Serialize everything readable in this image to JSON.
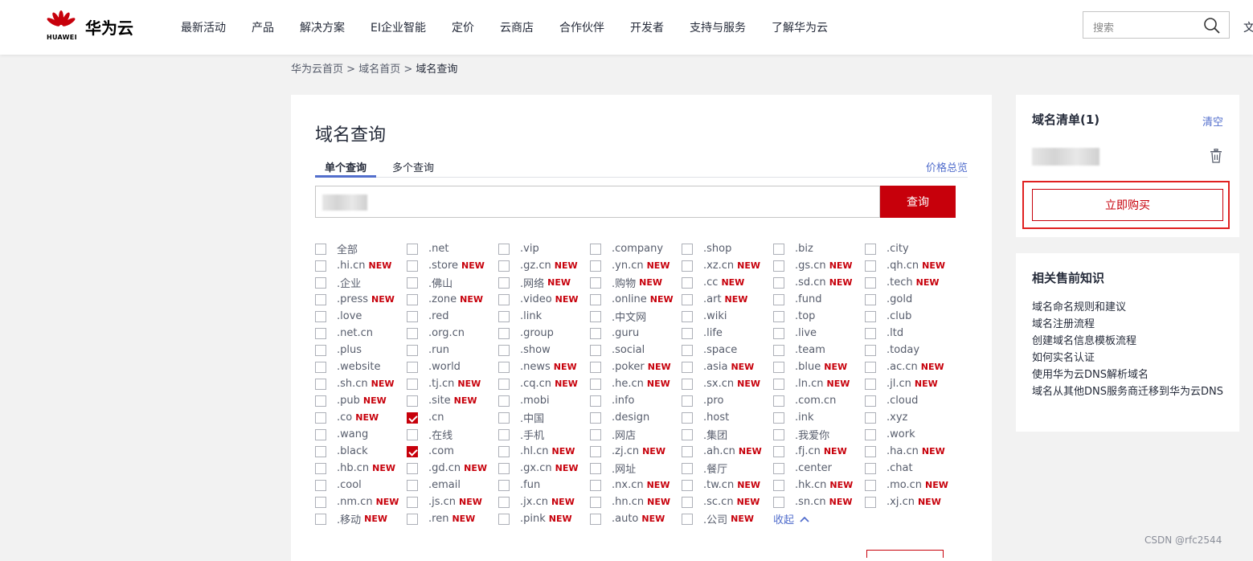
{
  "header": {
    "brand": "HUAWEI",
    "site_name": "华为云",
    "nav": [
      "最新活动",
      "产品",
      "解决方案",
      "EI企业智能",
      "定价",
      "云商店",
      "合作伙伴",
      "开发者",
      "支持与服务",
      "了解华为云"
    ],
    "search_placeholder": "搜索",
    "more": "文"
  },
  "breadcrumb": {
    "items": [
      "华为云首页",
      "域名首页"
    ],
    "current": "域名查询",
    "sep": ">"
  },
  "main": {
    "title": "域名查询",
    "tabs": [
      "单个查询",
      "多个查询"
    ],
    "price_link": "价格总览",
    "query_button": "查询",
    "new_tag": "NEW",
    "collapse": "收起",
    "suffix_rows": [
      [
        [
          "全部",
          false,
          false
        ],
        [
          ".net",
          false,
          false
        ],
        [
          ".vip",
          false,
          false
        ],
        [
          ".company",
          false,
          false
        ],
        [
          ".shop",
          false,
          false
        ],
        [
          ".biz",
          false,
          false
        ],
        [
          ".city",
          false,
          false
        ]
      ],
      [
        [
          ".hi.cn",
          true,
          false
        ],
        [
          ".store",
          true,
          false
        ],
        [
          ".gz.cn",
          true,
          false
        ],
        [
          ".yn.cn",
          true,
          false
        ],
        [
          ".xz.cn",
          true,
          false
        ],
        [
          ".gs.cn",
          true,
          false
        ],
        [
          ".qh.cn",
          true,
          false
        ]
      ],
      [
        [
          ".企业",
          false,
          false
        ],
        [
          ".佛山",
          false,
          false
        ],
        [
          ".网络",
          true,
          false
        ],
        [
          ".购物",
          true,
          false
        ],
        [
          ".cc",
          true,
          false
        ],
        [
          ".sd.cn",
          true,
          false
        ],
        [
          ".tech",
          true,
          false
        ]
      ],
      [
        [
          ".press",
          true,
          false
        ],
        [
          ".zone",
          true,
          false
        ],
        [
          ".video",
          true,
          false
        ],
        [
          ".online",
          true,
          false
        ],
        [
          ".art",
          true,
          false
        ],
        [
          ".fund",
          false,
          false
        ],
        [
          ".gold",
          false,
          false
        ]
      ],
      [
        [
          ".love",
          false,
          false
        ],
        [
          ".red",
          false,
          false
        ],
        [
          ".link",
          false,
          false
        ],
        [
          ".中文网",
          false,
          false
        ],
        [
          ".wiki",
          false,
          false
        ],
        [
          ".top",
          false,
          false
        ],
        [
          ".club",
          false,
          false
        ]
      ],
      [
        [
          ".net.cn",
          false,
          false
        ],
        [
          ".org.cn",
          false,
          false
        ],
        [
          ".group",
          false,
          false
        ],
        [
          ".guru",
          false,
          false
        ],
        [
          ".life",
          false,
          false
        ],
        [
          ".live",
          false,
          false
        ],
        [
          ".ltd",
          false,
          false
        ]
      ],
      [
        [
          ".plus",
          false,
          false
        ],
        [
          ".run",
          false,
          false
        ],
        [
          ".show",
          false,
          false
        ],
        [
          ".social",
          false,
          false
        ],
        [
          ".space",
          false,
          false
        ],
        [
          ".team",
          false,
          false
        ],
        [
          ".today",
          false,
          false
        ]
      ],
      [
        [
          ".website",
          false,
          false
        ],
        [
          ".world",
          false,
          false
        ],
        [
          ".news",
          true,
          false
        ],
        [
          ".poker",
          true,
          false
        ],
        [
          ".asia",
          true,
          false
        ],
        [
          ".blue",
          true,
          false
        ],
        [
          ".ac.cn",
          true,
          false
        ]
      ],
      [
        [
          ".sh.cn",
          true,
          false
        ],
        [
          ".tj.cn",
          true,
          false
        ],
        [
          ".cq.cn",
          true,
          false
        ],
        [
          ".he.cn",
          true,
          false
        ],
        [
          ".sx.cn",
          true,
          false
        ],
        [
          ".ln.cn",
          true,
          false
        ],
        [
          ".jl.cn",
          true,
          false
        ]
      ],
      [
        [
          ".pub",
          true,
          false
        ],
        [
          ".site",
          true,
          false
        ],
        [
          ".mobi",
          false,
          false
        ],
        [
          ".info",
          false,
          false
        ],
        [
          ".pro",
          false,
          false
        ],
        [
          ".com.cn",
          false,
          false
        ],
        [
          ".cloud",
          false,
          false
        ]
      ],
      [
        [
          ".co",
          true,
          false
        ],
        [
          ".cn",
          false,
          true
        ],
        [
          ".中国",
          false,
          false
        ],
        [
          ".design",
          false,
          false
        ],
        [
          ".host",
          false,
          false
        ],
        [
          ".ink",
          false,
          false
        ],
        [
          ".xyz",
          false,
          false
        ]
      ],
      [
        [
          ".wang",
          false,
          false
        ],
        [
          ".在线",
          false,
          false
        ],
        [
          ".手机",
          false,
          false
        ],
        [
          ".网店",
          false,
          false
        ],
        [
          ".集团",
          false,
          false
        ],
        [
          ".我爱你",
          false,
          false
        ],
        [
          ".work",
          false,
          false
        ]
      ],
      [
        [
          ".black",
          false,
          false
        ],
        [
          ".com",
          false,
          true
        ],
        [
          ".hl.cn",
          true,
          false
        ],
        [
          ".zj.cn",
          true,
          false
        ],
        [
          ".ah.cn",
          true,
          false
        ],
        [
          ".fj.cn",
          true,
          false
        ],
        [
          ".ha.cn",
          true,
          false
        ]
      ],
      [
        [
          ".hb.cn",
          true,
          false
        ],
        [
          ".gd.cn",
          true,
          false
        ],
        [
          ".gx.cn",
          true,
          false
        ],
        [
          ".网址",
          false,
          false
        ],
        [
          ".餐厅",
          false,
          false
        ],
        [
          ".center",
          false,
          false
        ],
        [
          ".chat",
          false,
          false
        ]
      ],
      [
        [
          ".cool",
          false,
          false
        ],
        [
          ".email",
          false,
          false
        ],
        [
          ".fun",
          false,
          false
        ],
        [
          ".nx.cn",
          true,
          false
        ],
        [
          ".tw.cn",
          true,
          false
        ],
        [
          ".hk.cn",
          true,
          false
        ],
        [
          ".mo.cn",
          true,
          false
        ]
      ],
      [
        [
          ".nm.cn",
          true,
          false
        ],
        [
          ".js.cn",
          true,
          false
        ],
        [
          ".jx.cn",
          true,
          false
        ],
        [
          ".hn.cn",
          true,
          false
        ],
        [
          ".sc.cn",
          true,
          false
        ],
        [
          ".sn.cn",
          true,
          false
        ],
        [
          ".xj.cn",
          true,
          false
        ]
      ],
      [
        [
          ".移动",
          true,
          false
        ],
        [
          ".ren",
          true,
          false
        ],
        [
          ".pink",
          true,
          false
        ],
        [
          ".auto",
          true,
          false
        ],
        [
          ".公司",
          true,
          false
        ]
      ]
    ]
  },
  "cart": {
    "title": "域名清单(1)",
    "clear": "清空",
    "buy": "立即购买"
  },
  "knowledge": {
    "title": "相关售前知识",
    "links": [
      "域名命名规则和建议",
      "域名注册流程",
      "创建域名信息模板流程",
      "如何实名认证",
      "使用华为云DNS解析域名",
      "域名从其他DNS服务商迁移到华为云DNS"
    ]
  },
  "watermark": "CSDN @rfc2544",
  "colors": {
    "brand_red": "#c7000b",
    "link_blue": "#526ecc",
    "highlight_red": "#e02020"
  }
}
